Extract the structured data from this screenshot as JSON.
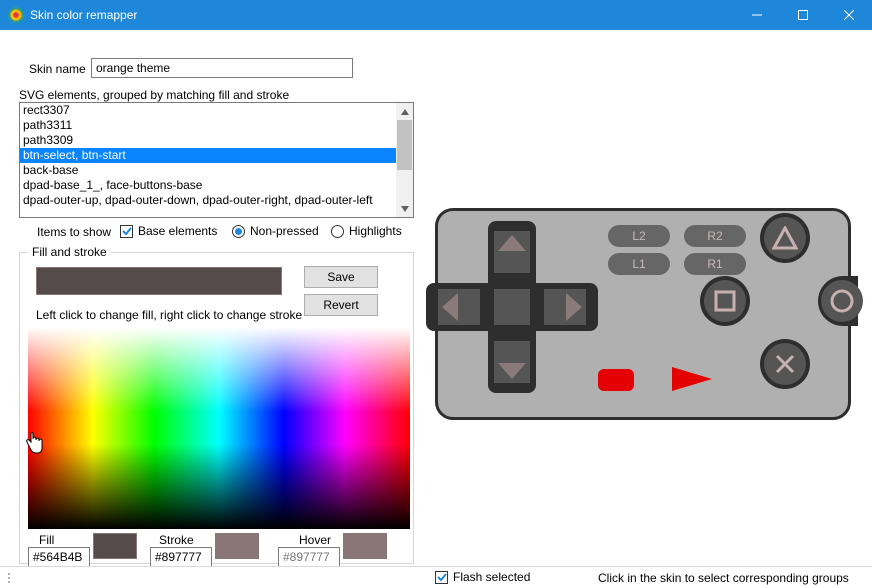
{
  "window": {
    "title": "Skin color remapper"
  },
  "skinName": {
    "label": "Skin name",
    "value": "orange theme"
  },
  "elements": {
    "heading": "SVG elements, grouped by matching fill and stroke",
    "items": [
      "rect3307",
      "path3311",
      "path3309",
      "btn-select, btn-start",
      "back-base",
      "dpad-base_1_, face-buttons-base",
      "dpad-outer-up, dpad-outer-down, dpad-outer-right, dpad-outer-left"
    ],
    "selectedIndex": 3
  },
  "itemsToShow": {
    "label": "Items to show",
    "baseElements": {
      "label": "Base elements",
      "checked": true
    },
    "group": {
      "nonPressed": {
        "label": "Non-pressed",
        "selected": true
      },
      "highlights": {
        "label": "Highlights",
        "selected": false
      }
    }
  },
  "fillStroke": {
    "legend": "Fill and stroke",
    "saveLabel": "Save",
    "revertLabel": "Revert",
    "hint": "Left click to change fill, right click to change stroke",
    "fill": {
      "label": "Fill",
      "value": "#564B4B",
      "swatch": "#564b4b"
    },
    "stroke": {
      "label": "Stroke",
      "value": "#897777",
      "swatch": "#897777"
    },
    "hover": {
      "label": "Hover",
      "placeholder": "#897777",
      "swatch": "#897777"
    }
  },
  "controller": {
    "L1": "L1",
    "L2": "L2",
    "R1": "R1",
    "R2": "R2"
  },
  "status": {
    "flashSelected": {
      "label": "Flash selected",
      "checked": true
    },
    "hint": "Click in the skin to select corresponding groups"
  }
}
